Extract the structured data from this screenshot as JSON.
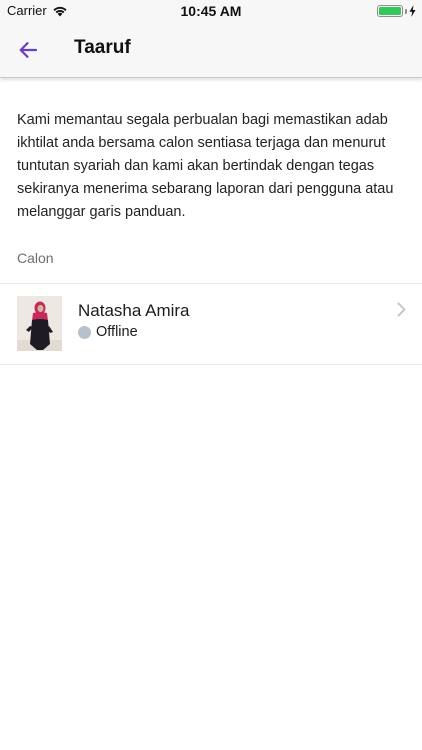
{
  "status_bar": {
    "carrier": "Carrier",
    "time": "10:45 AM",
    "battery_level": 1.0,
    "battery_color": "#34c759"
  },
  "nav": {
    "title": "Taaruf",
    "back_icon": "arrow-left-icon",
    "accent_color": "#6a3fc0"
  },
  "notice": {
    "text": "Kami memantau segala perbualan bagi memastikan adab ikhtilat anda bersama calon sentiasa terjaga dan menurut tuntutan syariah dan kami akan bertindak dengan tegas sekiranya menerima sebarang laporan dari pengguna atau melanggar garis panduan."
  },
  "candidates_section": {
    "header": "Calon",
    "items": [
      {
        "name": "Natasha Amira",
        "status": "Offline",
        "status_color": "#b7c0cb"
      }
    ]
  }
}
